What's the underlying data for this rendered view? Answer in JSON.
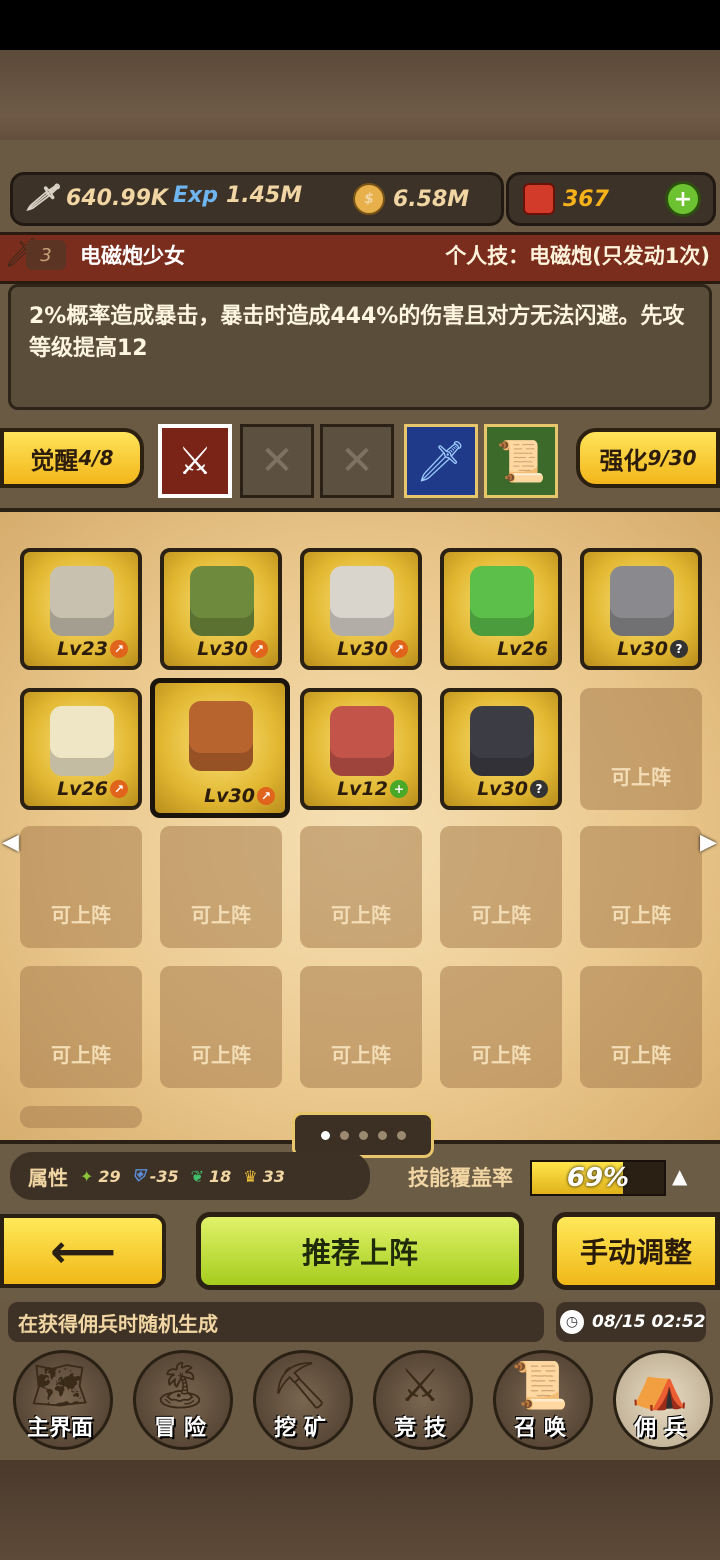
{
  "resources": {
    "attack": {
      "icon": "sword-icon",
      "value": "640.99K"
    },
    "exp": {
      "icon": "exp-icon",
      "label": "Exp",
      "value": "1.45M"
    },
    "gold": {
      "icon": "gold-coin-icon",
      "value": "6.58M"
    },
    "gem": {
      "icon": "ruby-icon",
      "value": "367"
    },
    "add": "+"
  },
  "skill": {
    "level": "3",
    "name": "电磁炮少女",
    "personal": "个人技：电磁炮(只发动1次)",
    "description": "2%概率造成暴击，暴击时造成444%的伤害且对方无法闪避。先攻等级提高12"
  },
  "awaken": {
    "label": "觉醒",
    "value": "4/8"
  },
  "enhance": {
    "label": "强化",
    "value": "9/30"
  },
  "equip_slots": [
    {
      "name": "crossed-blades-slot",
      "state": "selected"
    },
    {
      "name": "empty-slot",
      "state": "empty",
      "mark": "✕"
    },
    {
      "name": "empty-slot",
      "state": "empty",
      "mark": "✕"
    },
    {
      "name": "blue-sword-slot",
      "state": "filled"
    },
    {
      "name": "scroll-slot",
      "state": "filled"
    }
  ],
  "heroes": [
    {
      "lv": "Lv23",
      "badge": "orange",
      "color": "#c9c1b0"
    },
    {
      "lv": "Lv30",
      "badge": "orange",
      "color": "#6e8a3c"
    },
    {
      "lv": "Lv30",
      "badge": "orange",
      "color": "#d9d4cc"
    },
    {
      "lv": "Lv26",
      "badge": "none",
      "color": "#5cbf4a"
    },
    {
      "lv": "Lv30",
      "badge": "help",
      "color": "#8a8a8e"
    },
    {
      "lv": "Lv26",
      "badge": "orange",
      "color": "#efe6c6"
    },
    {
      "lv": "Lv30",
      "badge": "orange",
      "color": "#b7642e",
      "selected": true
    },
    {
      "lv": "Lv12",
      "badge": "plus",
      "color": "#c3544a"
    },
    {
      "lv": "Lv30",
      "badge": "help",
      "color": "#3c3c44"
    }
  ],
  "empty_slot_label": "可上阵",
  "attributes": {
    "label": "属性",
    "items": [
      {
        "icon": "nature-icon",
        "value": "29"
      },
      {
        "icon": "shield-icon",
        "value": "-35"
      },
      {
        "icon": "wing-icon",
        "value": "18"
      },
      {
        "icon": "crown-icon",
        "value": "33"
      }
    ]
  },
  "coverage": {
    "label": "技能覆盖率",
    "percent": 69,
    "text": "69%"
  },
  "buttons": {
    "back": "⟵",
    "recommend": "推荐上阵",
    "manual": "手动调整"
  },
  "info_text": "在获得佣兵时随机生成",
  "clock": "08/15 02:52",
  "nav": [
    {
      "label": "主界面",
      "icon": "map-scroll-icon"
    },
    {
      "label": "冒 险",
      "icon": "island-icon"
    },
    {
      "label": "挖 矿",
      "icon": "pickaxe-icon"
    },
    {
      "label": "竞 技",
      "icon": "crossed-swords-icon"
    },
    {
      "label": "召 唤",
      "icon": "summon-scroll-icon"
    },
    {
      "label": "佣 兵",
      "icon": "tent-icon"
    }
  ]
}
